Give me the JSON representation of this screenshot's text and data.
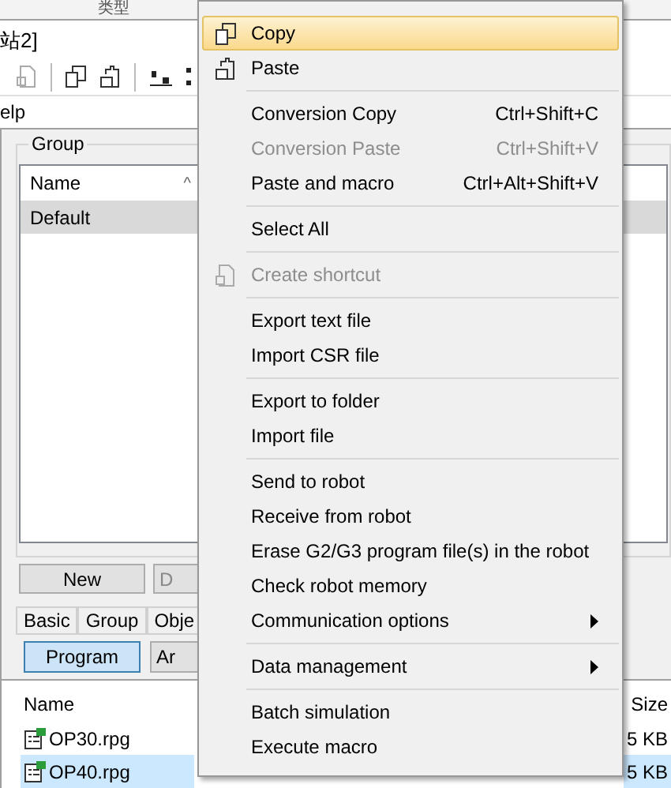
{
  "background": {
    "column_header": "类型",
    "window_title": "站2]",
    "menu_fragment": "elp",
    "group_panel": {
      "title": "Group",
      "column": "Name",
      "sort_mark": "^",
      "rows": [
        {
          "name": "Default",
          "selected": true
        }
      ],
      "buttons": [
        "New",
        "D"
      ]
    },
    "tabs": [
      "Basic",
      "Group",
      "Obje"
    ],
    "mode_buttons": [
      {
        "label": "Program",
        "selected": true
      },
      {
        "label": "Ar",
        "selected": false
      }
    ],
    "files": {
      "columns": [
        "Name",
        "Size"
      ],
      "rows": [
        {
          "name": "OP30.rpg",
          "size": "5 KB",
          "selected": false
        },
        {
          "name": "OP40.rpg",
          "size": "5 KB",
          "selected": true
        }
      ]
    }
  },
  "context_menu": {
    "items": [
      {
        "kind": "copy",
        "label": "Copy",
        "highlighted": true,
        "disabled": false
      },
      {
        "kind": "paste",
        "label": "Paste",
        "highlighted": false,
        "disabled": false
      },
      {
        "kind": "separator"
      },
      {
        "kind": "item",
        "label": "Conversion Copy",
        "shortcut": "Ctrl+Shift+C",
        "highlighted": false,
        "disabled": false
      },
      {
        "kind": "item",
        "label": "Conversion Paste",
        "shortcut": "Ctrl+Shift+V",
        "highlighted": false,
        "disabled": true
      },
      {
        "kind": "item",
        "label": "Paste and macro",
        "shortcut": "Ctrl+Alt+Shift+V",
        "highlighted": false,
        "disabled": false
      },
      {
        "kind": "separator"
      },
      {
        "kind": "item",
        "label": "Select All",
        "highlighted": false,
        "disabled": false
      },
      {
        "kind": "separator"
      },
      {
        "kind": "shortcut",
        "label": "Create shortcut",
        "highlighted": false,
        "disabled": true
      },
      {
        "kind": "separator"
      },
      {
        "kind": "item",
        "label": "Export text file",
        "highlighted": false,
        "disabled": false
      },
      {
        "kind": "item",
        "label": "Import CSR file",
        "highlighted": false,
        "disabled": false
      },
      {
        "kind": "separator"
      },
      {
        "kind": "item",
        "label": "Export to folder",
        "highlighted": false,
        "disabled": false
      },
      {
        "kind": "item",
        "label": "Import file",
        "highlighted": false,
        "disabled": false
      },
      {
        "kind": "separator"
      },
      {
        "kind": "item",
        "label": "Send to robot",
        "highlighted": false,
        "disabled": false
      },
      {
        "kind": "item",
        "label": "Receive from robot",
        "highlighted": false,
        "disabled": false
      },
      {
        "kind": "item",
        "label": "Erase G2/G3 program file(s) in the robot",
        "highlighted": false,
        "disabled": false
      },
      {
        "kind": "item",
        "label": "Check robot memory",
        "highlighted": false,
        "disabled": false
      },
      {
        "kind": "submenu",
        "label": "Communication options",
        "highlighted": false,
        "disabled": false
      },
      {
        "kind": "separator"
      },
      {
        "kind": "submenu",
        "label": "Data management",
        "highlighted": false,
        "disabled": false
      },
      {
        "kind": "separator"
      },
      {
        "kind": "item",
        "label": "Batch simulation",
        "highlighted": false,
        "disabled": false
      },
      {
        "kind": "item",
        "label": "Execute macro",
        "highlighted": false,
        "disabled": false
      }
    ]
  }
}
